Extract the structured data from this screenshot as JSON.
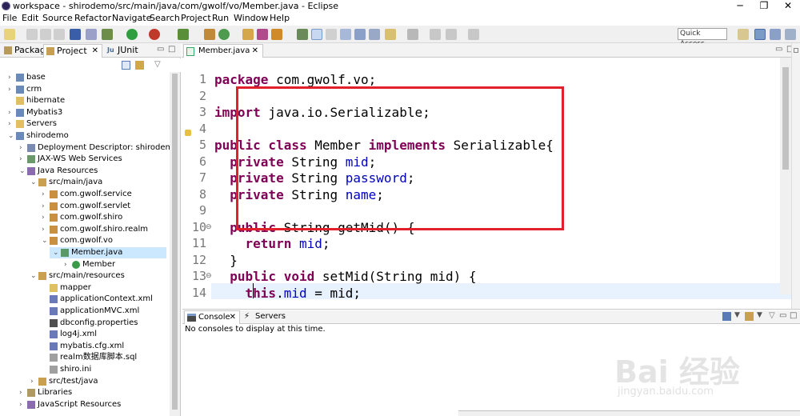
{
  "window": {
    "title": "workspace - shirodemo/src/main/java/com/gwolf/vo/Member.java - Eclipse"
  },
  "menu": [
    "File",
    "Edit",
    "Source",
    "Refactor",
    "Navigate",
    "Search",
    "Project",
    "Run",
    "Window",
    "Help"
  ],
  "toolbar": {
    "quick_access": "Quick Access"
  },
  "left_panel": {
    "tabs": [
      "Packag",
      "Project",
      "JUnit"
    ],
    "tree": [
      {
        "label": "base",
        "indent": 0,
        "twisty": "›",
        "icon": "project"
      },
      {
        "label": "crm",
        "indent": 0,
        "twisty": "›",
        "icon": "project"
      },
      {
        "label": "hibernate",
        "indent": 0,
        "twisty": "",
        "icon": "folder"
      },
      {
        "label": "Mybatis3",
        "indent": 0,
        "twisty": "›",
        "icon": "project"
      },
      {
        "label": "Servers",
        "indent": 0,
        "twisty": "›",
        "icon": "folder"
      },
      {
        "label": "shirodemo",
        "indent": 0,
        "twisty": "⌄",
        "icon": "project"
      },
      {
        "label": "Deployment Descriptor: shirodemo",
        "indent": 1,
        "twisty": "›",
        "icon": "descriptor"
      },
      {
        "label": "JAX-WS Web Services",
        "indent": 1,
        "twisty": "›",
        "icon": "webservice"
      },
      {
        "label": "Java Resources",
        "indent": 1,
        "twisty": "⌄",
        "icon": "resources"
      },
      {
        "label": "src/main/java",
        "indent": 2,
        "twisty": "⌄",
        "icon": "srcfolder"
      },
      {
        "label": "com.gwolf.service",
        "indent": 3,
        "twisty": "›",
        "icon": "package"
      },
      {
        "label": "com.gwolf.servlet",
        "indent": 3,
        "twisty": "›",
        "icon": "package"
      },
      {
        "label": "com.gwolf.shiro",
        "indent": 3,
        "twisty": "›",
        "icon": "package"
      },
      {
        "label": "com.gwolf.shiro.realm",
        "indent": 3,
        "twisty": "›",
        "icon": "package"
      },
      {
        "label": "com.gwolf.vo",
        "indent": 3,
        "twisty": "⌄",
        "icon": "package"
      },
      {
        "label": "Member.java",
        "indent": 4,
        "twisty": "⌄",
        "icon": "javafile",
        "selected": true
      },
      {
        "label": "Member",
        "indent": 5,
        "twisty": "›",
        "icon": "class"
      },
      {
        "label": "src/main/resources",
        "indent": 2,
        "twisty": "⌄",
        "icon": "srcfolder"
      },
      {
        "label": "mapper",
        "indent": 3,
        "twisty": "",
        "icon": "folder"
      },
      {
        "label": "applicationContext.xml",
        "indent": 3,
        "twisty": "",
        "icon": "xml"
      },
      {
        "label": "applicationMVC.xml",
        "indent": 3,
        "twisty": "",
        "icon": "xml"
      },
      {
        "label": "dbconfig.properties",
        "indent": 3,
        "twisty": "",
        "icon": "props"
      },
      {
        "label": "log4j.xml",
        "indent": 3,
        "twisty": "",
        "icon": "xml"
      },
      {
        "label": "mybatis.cfg.xml",
        "indent": 3,
        "twisty": "",
        "icon": "xml"
      },
      {
        "label": "realm数据库脚本.sql",
        "indent": 3,
        "twisty": "",
        "icon": "file"
      },
      {
        "label": "shiro.ini",
        "indent": 3,
        "twisty": "",
        "icon": "file"
      },
      {
        "label": "src/test/java",
        "indent": 2,
        "twisty": "›",
        "icon": "srcfolder"
      },
      {
        "label": "Libraries",
        "indent": 1,
        "twisty": "›",
        "icon": "library"
      },
      {
        "label": "JavaScript Resources",
        "indent": 1,
        "twisty": "›",
        "icon": "resources"
      }
    ]
  },
  "editor": {
    "tab_label": "Member.java",
    "lines": [
      {
        "n": "1",
        "marker": "",
        "tokens": [
          [
            "kw",
            "package"
          ],
          [
            "t",
            " com.gwolf.vo;"
          ]
        ]
      },
      {
        "n": "2",
        "marker": "",
        "tokens": []
      },
      {
        "n": "3",
        "marker": "",
        "tokens": [
          [
            "kw",
            "import"
          ],
          [
            "t",
            " java.io.Serializable;"
          ]
        ]
      },
      {
        "n": "4",
        "marker": "",
        "tokens": []
      },
      {
        "n": "5",
        "marker": "",
        "tokens": [
          [
            "kw",
            "public class"
          ],
          [
            "t",
            " Member "
          ],
          [
            "kw",
            "implements"
          ],
          [
            "t",
            " Serializable{"
          ]
        ]
      },
      {
        "n": "6",
        "marker": "",
        "tokens": [
          [
            "t",
            "  "
          ],
          [
            "kw",
            "private"
          ],
          [
            "t",
            " String "
          ],
          [
            "fd",
            "mid"
          ],
          [
            "t",
            ";"
          ]
        ]
      },
      {
        "n": "7",
        "marker": "",
        "tokens": [
          [
            "t",
            "  "
          ],
          [
            "kw",
            "private"
          ],
          [
            "t",
            " String "
          ],
          [
            "fd",
            "password"
          ],
          [
            "t",
            ";"
          ]
        ]
      },
      {
        "n": "8",
        "marker": "",
        "tokens": [
          [
            "t",
            "  "
          ],
          [
            "kw",
            "private"
          ],
          [
            "t",
            " String "
          ],
          [
            "fd",
            "name"
          ],
          [
            "t",
            ";"
          ]
        ]
      },
      {
        "n": "9",
        "marker": "",
        "tokens": []
      },
      {
        "n": "10",
        "marker": "⊖",
        "tokens": [
          [
            "t",
            "  "
          ],
          [
            "kw",
            "public"
          ],
          [
            "t",
            " String getMid() {"
          ]
        ]
      },
      {
        "n": "11",
        "marker": "",
        "tokens": [
          [
            "t",
            "    "
          ],
          [
            "kw",
            "return"
          ],
          [
            "t",
            " "
          ],
          [
            "fd",
            "mid"
          ],
          [
            "t",
            ";"
          ]
        ]
      },
      {
        "n": "12",
        "marker": "",
        "tokens": [
          [
            "t",
            "  }"
          ]
        ]
      },
      {
        "n": "13",
        "marker": "⊖",
        "tokens": [
          [
            "t",
            "  "
          ],
          [
            "kw",
            "public void"
          ],
          [
            "t",
            " setMid(String mid) {"
          ]
        ]
      },
      {
        "n": "14",
        "marker": "",
        "tokens": [
          [
            "t",
            "    "
          ],
          [
            "kw",
            "this"
          ],
          [
            "t",
            "."
          ],
          [
            "fd",
            "mid"
          ],
          [
            "t",
            " = mid;"
          ]
        ]
      }
    ]
  },
  "console": {
    "tabs": [
      "Console",
      "Servers"
    ],
    "message": "No consoles to display at this time."
  },
  "watermark": {
    "brand": "Bai 经验",
    "url": "jingyan.baidu.com"
  },
  "colors": {
    "keyword": "#7f0055",
    "field": "#0000c0",
    "highlight_box": "#e0202a",
    "selection": "#cce8ff",
    "current_line": "#e8f2fe"
  }
}
